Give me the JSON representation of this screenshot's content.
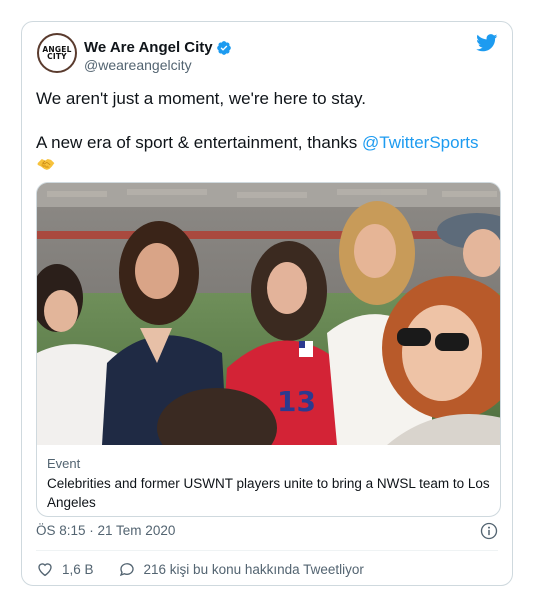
{
  "tweet": {
    "avatar_text": [
      "ANGEL",
      "CITY"
    ],
    "display_name": "We Are Angel City",
    "handle": "@weareangelcity",
    "text_line1": "We aren't just a moment, we're here to stay.",
    "text_line2_prefix": "A new era of sport & entertainment, thanks ",
    "mention": "@TwitterSports",
    "emoji": "handshake-emoji",
    "card": {
      "kind": "Event",
      "title": "Celebrities and former USWNT players unite to bring a NWSL team to Los Angeles",
      "jersey_number": "13"
    },
    "timestamp": "ÖS 8:15 · 21 Tem 2020",
    "likes": "1,6 B",
    "discussion": "216 kişi bu konu hakkında Tweetliyor"
  },
  "icons": {
    "verified": "verified-badge-icon",
    "bird": "twitter-bird-icon",
    "info": "info-icon",
    "heart": "heart-icon",
    "reply": "speech-bubble-icon"
  },
  "colors": {
    "accent": "#1d9bf0",
    "secondary_text": "#536471",
    "border": "#cfd9de",
    "jersey": "#d32336"
  }
}
